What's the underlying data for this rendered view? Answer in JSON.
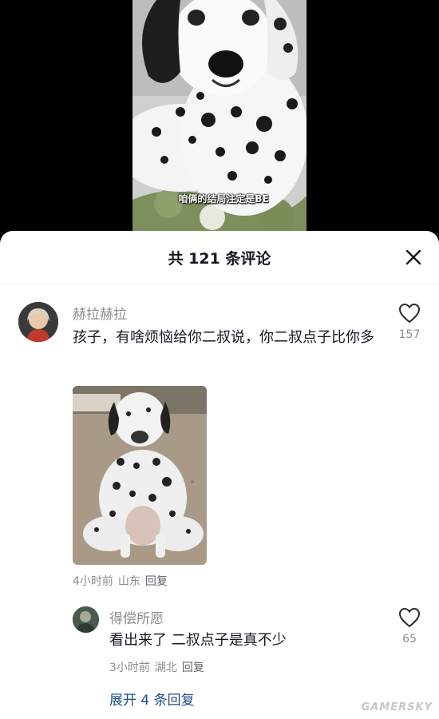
{
  "video": {
    "subtitle": "咱俩的结局注定是BE"
  },
  "sheet": {
    "title": "共 121 条评论"
  },
  "comments": [
    {
      "username": "赫拉赫拉",
      "text": "孩子，有啥烦恼给你二叔说，你二叔点子比你多",
      "like_count": "157",
      "time": "4小时前",
      "location": "山东",
      "reply_label": "回复",
      "replies": [
        {
          "username": "得偿所愿",
          "text": "看出来了 二叔点子是真不少",
          "like_count": "65",
          "time": "3小时前",
          "location": "湖北",
          "reply_label": "回复"
        }
      ],
      "expand_label": "展开 4 条回复"
    }
  ],
  "watermark": "GAMERSKY",
  "colors": {
    "link": "#1f4e8c",
    "muted": "#8a8b91",
    "text": "#161823"
  }
}
